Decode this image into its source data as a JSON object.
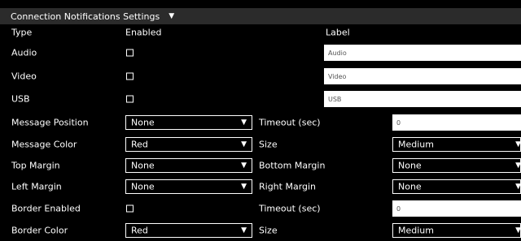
{
  "panel": {
    "title": "Connection Notifications Settings",
    "caret": "▼"
  },
  "header": {
    "type": "Type",
    "enabled": "Enabled",
    "label": "Label"
  },
  "connections": [
    {
      "type": "Audio",
      "enabled": false,
      "label_value": "Audio"
    },
    {
      "type": "Video",
      "enabled": false,
      "label_value": "Video"
    },
    {
      "type": "USB",
      "enabled": false,
      "label_value": "USB"
    }
  ],
  "message_position": {
    "label": "Message Position",
    "value": "None"
  },
  "timeout_1": {
    "label": "Timeout (sec)",
    "value": "0"
  },
  "message_color": {
    "label": "Message Color",
    "value": "Red"
  },
  "size_1": {
    "label": "Size",
    "value": "Medium"
  },
  "top_margin": {
    "label": "Top Margin",
    "value": "None"
  },
  "bottom_margin": {
    "label": "Bottom Margin",
    "value": "None"
  },
  "left_margin": {
    "label": "Left Margin",
    "value": "None"
  },
  "right_margin": {
    "label": "Right Margin",
    "value": "None"
  },
  "border_enabled": {
    "label": "Border Enabled",
    "checked": false
  },
  "timeout_2": {
    "label": "Timeout (sec)",
    "value": "0"
  },
  "border_color": {
    "label": "Border Color",
    "value": "Red"
  },
  "size_2": {
    "label": "Size",
    "value": "Medium"
  },
  "icons": {
    "dropdown_arrow": "dropdown-caret-icon",
    "checkbox": "checkbox-icon"
  },
  "colors": {
    "background": "#000000",
    "title_bar": "#2b2b2b",
    "text": "#ffffff",
    "input_bg": "#ffffff"
  }
}
